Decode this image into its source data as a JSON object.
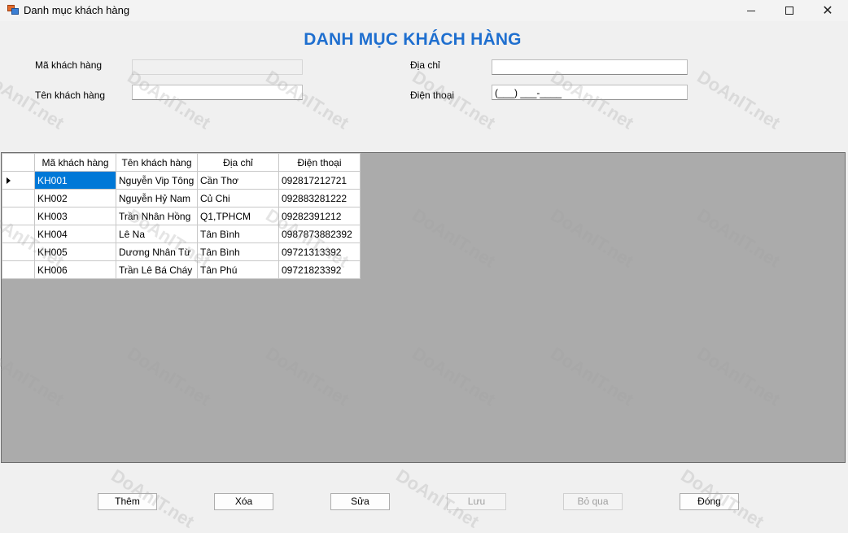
{
  "window": {
    "title": "Danh mục khách hàng",
    "controls": [
      "minimize",
      "maximize",
      "close"
    ]
  },
  "form": {
    "heading": "DANH MỤC KHÁCH HÀNG",
    "fields": {
      "ma_kh": {
        "label": "Mã khách hàng",
        "value": ""
      },
      "ten_kh": {
        "label": "Tên khách hàng",
        "value": ""
      },
      "dia_chi": {
        "label": "Địa chỉ",
        "value": ""
      },
      "dien_thoai": {
        "label": "Điện thoại",
        "value": "(___) ___-____"
      }
    }
  },
  "grid": {
    "columns": [
      "Mã khách hàng",
      "Tên khách hàng",
      "Địa chỉ",
      "Điện thoại"
    ],
    "rows": [
      [
        "KH001",
        "Nguyễn Vip Tông",
        "Cần Thơ",
        "092817212721"
      ],
      [
        "KH002",
        "Nguyễn Hỷ Nam",
        "Củ Chi",
        "092883281222"
      ],
      [
        "KH003",
        "Trần Nhân Hồng",
        "Q1,TPHCM",
        "09282391212"
      ],
      [
        "KH004",
        "Lê Na",
        "Tân Bình",
        "0987873882392"
      ],
      [
        "KH005",
        "Dương Nhân Từ",
        "Tân Bình",
        "09721313392"
      ],
      [
        "KH006",
        "Trần Lê Bá Cháy",
        "Tân Phú",
        "09721823392"
      ]
    ],
    "selected_row": 0
  },
  "buttons": {
    "them": "Thêm",
    "xoa": "Xóa",
    "sua": "Sửa",
    "luu": "Lưu",
    "bo_qua": "Bỏ qua",
    "dong": "Đóng"
  },
  "watermark": "DoAnIT.net"
}
